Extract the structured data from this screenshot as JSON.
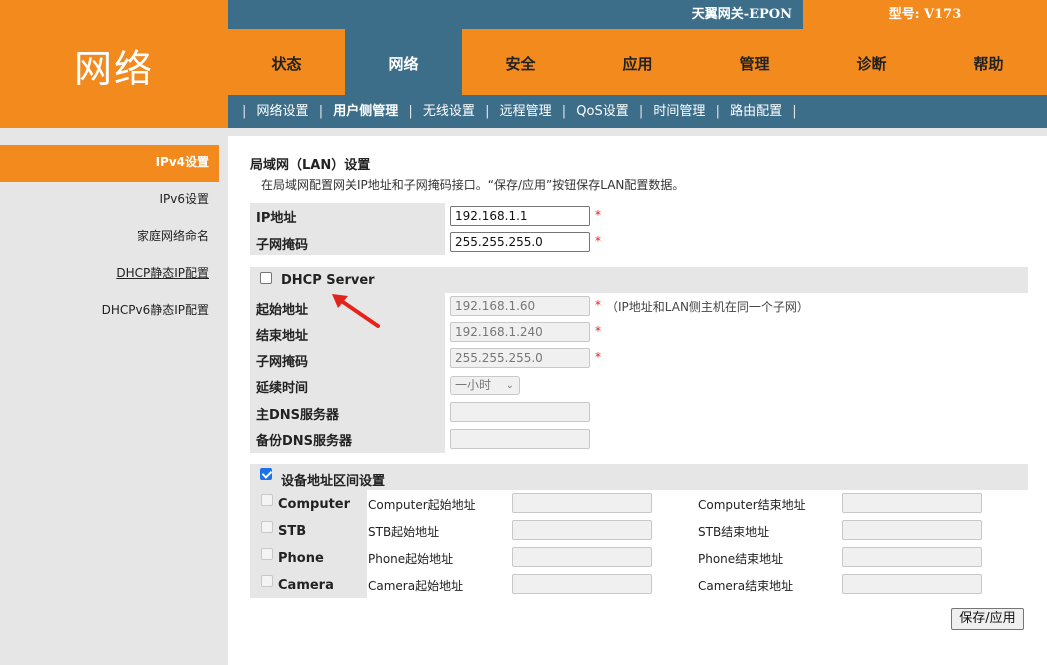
{
  "header": {
    "logo_title": "网络",
    "brand": "天翼网关-EPON",
    "model": "型号: V173"
  },
  "main_nav": [
    {
      "label": "状态",
      "active": false
    },
    {
      "label": "网络",
      "active": true
    },
    {
      "label": "安全",
      "active": false
    },
    {
      "label": "应用",
      "active": false
    },
    {
      "label": "管理",
      "active": false
    },
    {
      "label": "诊断",
      "active": false
    },
    {
      "label": "帮助",
      "active": false
    }
  ],
  "sub_nav": {
    "separator": "|",
    "items": [
      {
        "label": "网络设置",
        "active": false
      },
      {
        "label": "用户侧管理",
        "active": true
      },
      {
        "label": "无线设置",
        "active": false
      },
      {
        "label": "远程管理",
        "active": false
      },
      {
        "label": "QoS设置",
        "active": false
      },
      {
        "label": "时间管理",
        "active": false
      },
      {
        "label": "路由配置",
        "active": false
      }
    ]
  },
  "sidebar": {
    "items": [
      {
        "label": "IPv4设置",
        "active": true
      },
      {
        "label": "IPv6设置",
        "active": false
      },
      {
        "label": "家庭网络命名",
        "active": false
      },
      {
        "label": "DHCP静态IP配置",
        "active": false,
        "underline": true
      },
      {
        "label": "DHCPv6静态IP配置",
        "active": false
      }
    ]
  },
  "lan": {
    "title": "局域网（LAN）设置",
    "description": "在局域网配置网关IP地址和子网掩码接口。“保存/应用”按钮保存LAN配置数据。",
    "ip_label": "IP地址",
    "ip_value": "192.168.1.1",
    "mask_label": "子网掩码",
    "mask_value": "255.255.255.0",
    "required_mark": "*"
  },
  "dhcp": {
    "title": "DHCP Server",
    "enabled": false,
    "start_label": "起始地址",
    "start_value": "192.168.1.60",
    "start_hint": "（IP地址和LAN侧主机在同一个子网）",
    "end_label": "结束地址",
    "end_value": "192.168.1.240",
    "mask_label": "子网掩码",
    "mask_value": "255.255.255.0",
    "lease_label": "延续时间",
    "lease_value": "一小时",
    "dns1_label": "主DNS服务器",
    "dns1_value": "",
    "dns2_label": "备份DNS服务器",
    "dns2_value": ""
  },
  "device_range": {
    "title": "设备地址区间设置",
    "enabled": true,
    "rows": [
      {
        "name": "Computer",
        "start_label": "Computer起始地址",
        "end_label": "Computer结束地址"
      },
      {
        "name": "STB",
        "start_label": "STB起始地址",
        "end_label": "STB结束地址"
      },
      {
        "name": "Phone",
        "start_label": "Phone起始地址",
        "end_label": "Phone结束地址"
      },
      {
        "name": "Camera",
        "start_label": "Camera起始地址",
        "end_label": "Camera结束地址"
      }
    ]
  },
  "actions": {
    "save_label": "保存/应用"
  },
  "colors": {
    "orange": "#f28a1e",
    "blue": "#3c6e8a",
    "annotation_arrow": "#e5231b"
  },
  "icons": {
    "annotation": "red-arrow-icon",
    "select_chevron": "chevron-down-icon"
  }
}
